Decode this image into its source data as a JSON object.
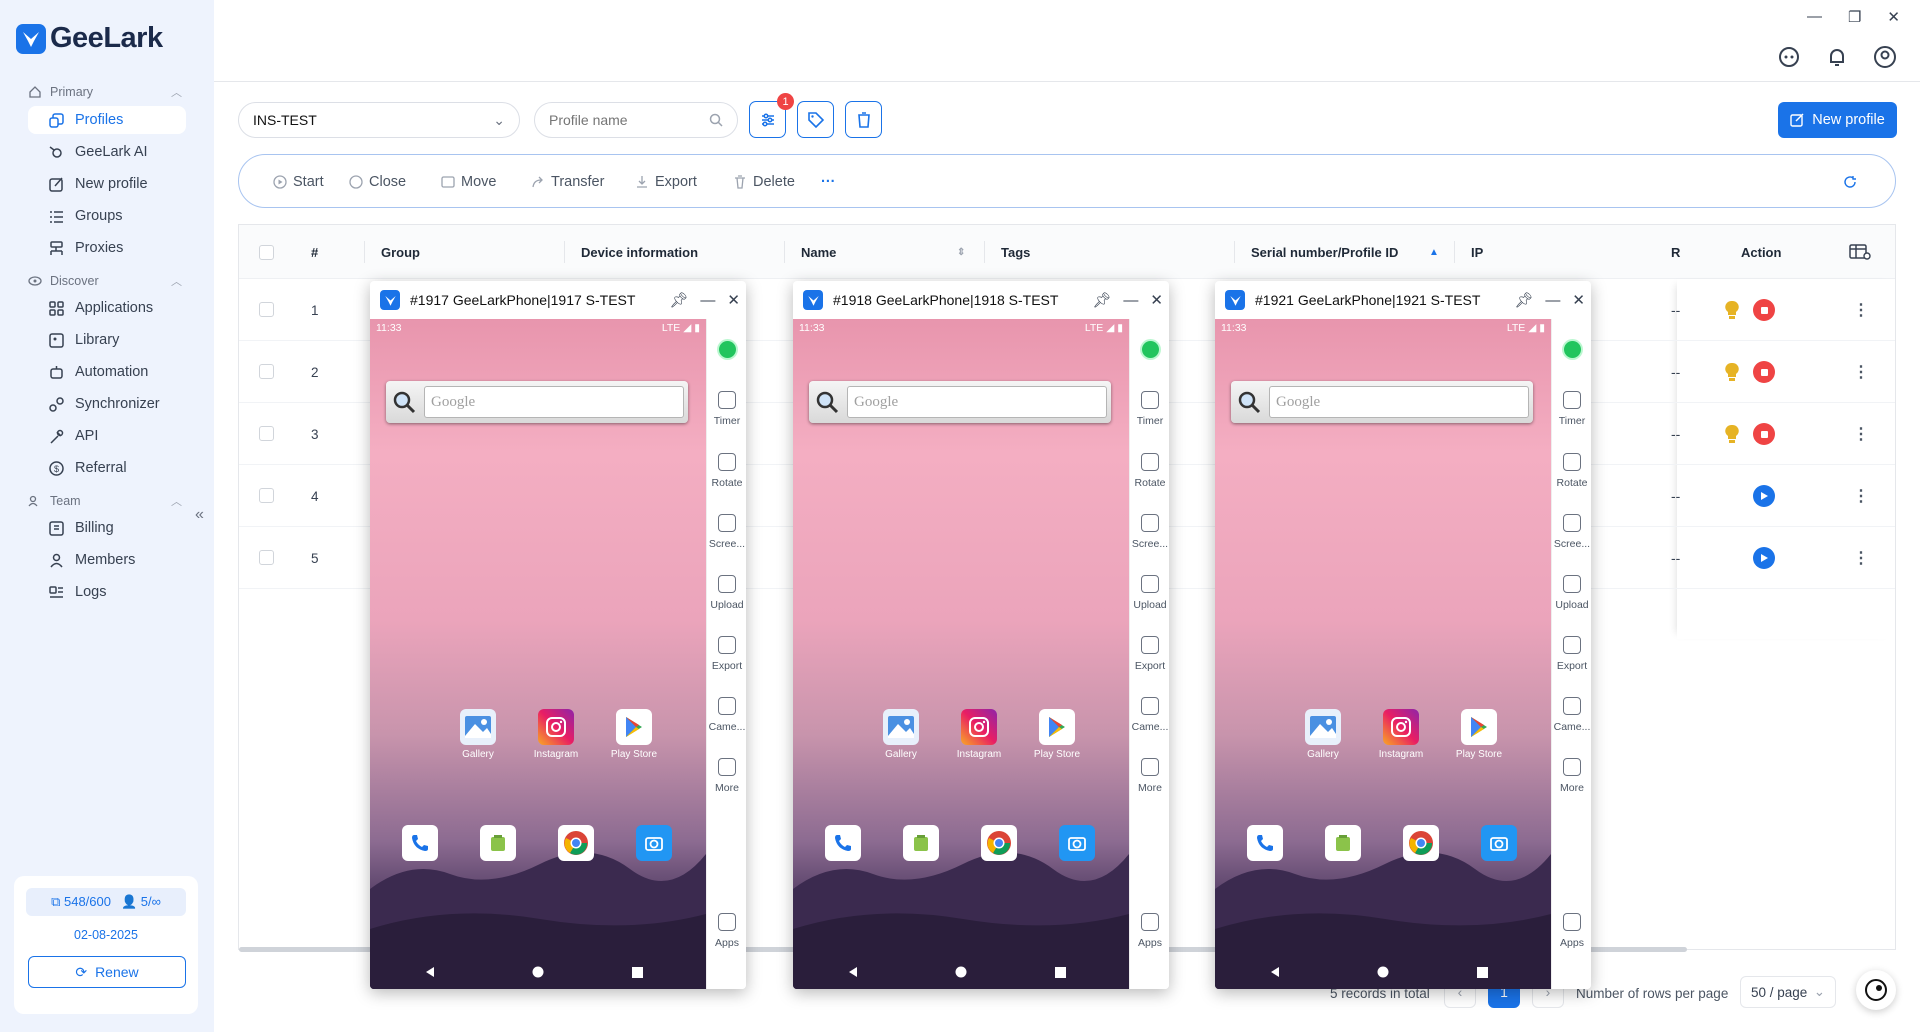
{
  "window": {
    "minimize": "—",
    "maximize": "❐",
    "close": "✕"
  },
  "brand": {
    "name": "GeeLark"
  },
  "sidebar": {
    "sections": [
      {
        "label": "Primary"
      },
      {
        "label": "Discover"
      },
      {
        "label": "Team"
      }
    ],
    "items": [
      {
        "label": "Profiles"
      },
      {
        "label": "GeeLark AI"
      },
      {
        "label": "New profile"
      },
      {
        "label": "Groups"
      },
      {
        "label": "Proxies"
      },
      {
        "label": "Applications"
      },
      {
        "label": "Library"
      },
      {
        "label": "Automation"
      },
      {
        "label": "Synchronizer"
      },
      {
        "label": "API"
      },
      {
        "label": "Referral"
      },
      {
        "label": "Billing"
      },
      {
        "label": "Members"
      },
      {
        "label": "Logs"
      }
    ],
    "quota": {
      "profiles": "548/600",
      "members": "5/∞",
      "date": "02-08-2025",
      "renew": "Renew"
    }
  },
  "filters": {
    "group_value": "INS-TEST",
    "search_placeholder": "Profile name",
    "filter_badge": "1",
    "new_profile": "New profile"
  },
  "toolbar": {
    "start": "Start",
    "close": "Close",
    "move": "Move",
    "transfer": "Transfer",
    "export": "Export",
    "delete": "Delete",
    "more": "···"
  },
  "table": {
    "headers": {
      "num": "#",
      "group": "Group",
      "device": "Device information",
      "name": "Name",
      "tags": "Tags",
      "serial": "Serial number/Profile ID",
      "ip": "IP",
      "r": "R",
      "action": "Action"
    },
    "rows": [
      {
        "num": "1",
        "dash": "--",
        "state": "running"
      },
      {
        "num": "2",
        "dash": "--",
        "state": "running"
      },
      {
        "num": "3",
        "dash": "--",
        "state": "running"
      },
      {
        "num": "4",
        "dash": "--",
        "state": "stopped"
      },
      {
        "num": "5",
        "dash": "--",
        "state": "stopped"
      }
    ]
  },
  "pagination": {
    "total": "5 records in total",
    "current": "1",
    "rows_label": "Number of rows per page",
    "rows_value": "50 / page"
  },
  "phones": [
    {
      "title": "#1917 GeeLarkPhone|1917 S-TEST"
    },
    {
      "title": "#1918 GeeLarkPhone|1918 S-TEST"
    },
    {
      "title": "#1921 GeeLarkPhone|1921 S-TEST"
    }
  ],
  "phone_ui": {
    "time": "11:33",
    "net": "LTE ◢ ▮",
    "search_hint": "Google",
    "apps": {
      "gallery": "Gallery",
      "instagram": "Instagram",
      "play": "Play Store"
    },
    "side": {
      "timer": "Timer",
      "rotate": "Rotate",
      "screen": "Scree...",
      "upload": "Upload",
      "export": "Export",
      "camera": "Came...",
      "more": "More",
      "apps": "Apps"
    }
  },
  "colors": {
    "accent": "#1a73e8",
    "danger": "#ef4444",
    "sidebar_bg": "#eef3fd"
  }
}
